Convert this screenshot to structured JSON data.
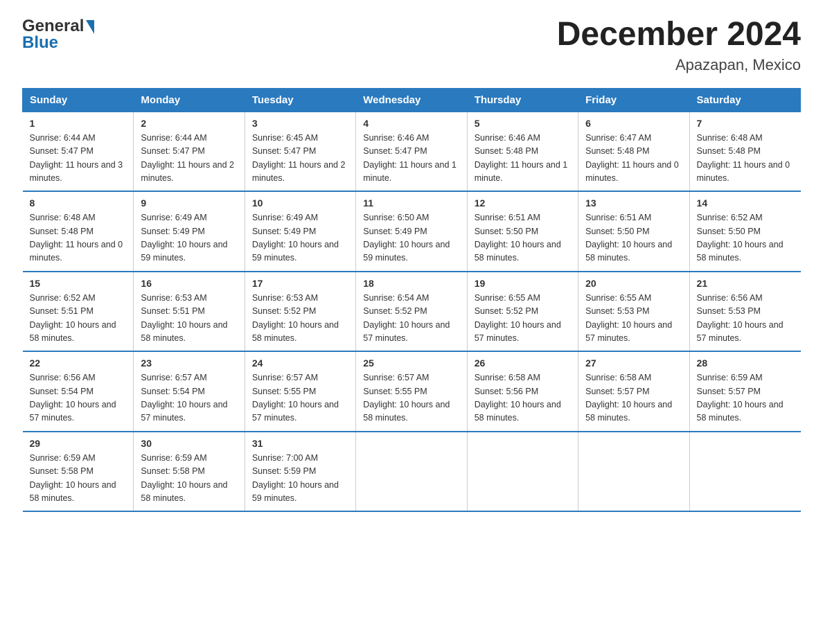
{
  "header": {
    "logo_general": "General",
    "logo_blue": "Blue",
    "month_title": "December 2024",
    "location": "Apazapan, Mexico"
  },
  "days_of_week": [
    "Sunday",
    "Monday",
    "Tuesday",
    "Wednesday",
    "Thursday",
    "Friday",
    "Saturday"
  ],
  "weeks": [
    [
      {
        "day": "1",
        "sunrise": "6:44 AM",
        "sunset": "5:47 PM",
        "daylight": "11 hours and 3 minutes."
      },
      {
        "day": "2",
        "sunrise": "6:44 AM",
        "sunset": "5:47 PM",
        "daylight": "11 hours and 2 minutes."
      },
      {
        "day": "3",
        "sunrise": "6:45 AM",
        "sunset": "5:47 PM",
        "daylight": "11 hours and 2 minutes."
      },
      {
        "day": "4",
        "sunrise": "6:46 AM",
        "sunset": "5:47 PM",
        "daylight": "11 hours and 1 minute."
      },
      {
        "day": "5",
        "sunrise": "6:46 AM",
        "sunset": "5:48 PM",
        "daylight": "11 hours and 1 minute."
      },
      {
        "day": "6",
        "sunrise": "6:47 AM",
        "sunset": "5:48 PM",
        "daylight": "11 hours and 0 minutes."
      },
      {
        "day": "7",
        "sunrise": "6:48 AM",
        "sunset": "5:48 PM",
        "daylight": "11 hours and 0 minutes."
      }
    ],
    [
      {
        "day": "8",
        "sunrise": "6:48 AM",
        "sunset": "5:48 PM",
        "daylight": "11 hours and 0 minutes."
      },
      {
        "day": "9",
        "sunrise": "6:49 AM",
        "sunset": "5:49 PM",
        "daylight": "10 hours and 59 minutes."
      },
      {
        "day": "10",
        "sunrise": "6:49 AM",
        "sunset": "5:49 PM",
        "daylight": "10 hours and 59 minutes."
      },
      {
        "day": "11",
        "sunrise": "6:50 AM",
        "sunset": "5:49 PM",
        "daylight": "10 hours and 59 minutes."
      },
      {
        "day": "12",
        "sunrise": "6:51 AM",
        "sunset": "5:50 PM",
        "daylight": "10 hours and 58 minutes."
      },
      {
        "day": "13",
        "sunrise": "6:51 AM",
        "sunset": "5:50 PM",
        "daylight": "10 hours and 58 minutes."
      },
      {
        "day": "14",
        "sunrise": "6:52 AM",
        "sunset": "5:50 PM",
        "daylight": "10 hours and 58 minutes."
      }
    ],
    [
      {
        "day": "15",
        "sunrise": "6:52 AM",
        "sunset": "5:51 PM",
        "daylight": "10 hours and 58 minutes."
      },
      {
        "day": "16",
        "sunrise": "6:53 AM",
        "sunset": "5:51 PM",
        "daylight": "10 hours and 58 minutes."
      },
      {
        "day": "17",
        "sunrise": "6:53 AM",
        "sunset": "5:52 PM",
        "daylight": "10 hours and 58 minutes."
      },
      {
        "day": "18",
        "sunrise": "6:54 AM",
        "sunset": "5:52 PM",
        "daylight": "10 hours and 57 minutes."
      },
      {
        "day": "19",
        "sunrise": "6:55 AM",
        "sunset": "5:52 PM",
        "daylight": "10 hours and 57 minutes."
      },
      {
        "day": "20",
        "sunrise": "6:55 AM",
        "sunset": "5:53 PM",
        "daylight": "10 hours and 57 minutes."
      },
      {
        "day": "21",
        "sunrise": "6:56 AM",
        "sunset": "5:53 PM",
        "daylight": "10 hours and 57 minutes."
      }
    ],
    [
      {
        "day": "22",
        "sunrise": "6:56 AM",
        "sunset": "5:54 PM",
        "daylight": "10 hours and 57 minutes."
      },
      {
        "day": "23",
        "sunrise": "6:57 AM",
        "sunset": "5:54 PM",
        "daylight": "10 hours and 57 minutes."
      },
      {
        "day": "24",
        "sunrise": "6:57 AM",
        "sunset": "5:55 PM",
        "daylight": "10 hours and 57 minutes."
      },
      {
        "day": "25",
        "sunrise": "6:57 AM",
        "sunset": "5:55 PM",
        "daylight": "10 hours and 58 minutes."
      },
      {
        "day": "26",
        "sunrise": "6:58 AM",
        "sunset": "5:56 PM",
        "daylight": "10 hours and 58 minutes."
      },
      {
        "day": "27",
        "sunrise": "6:58 AM",
        "sunset": "5:57 PM",
        "daylight": "10 hours and 58 minutes."
      },
      {
        "day": "28",
        "sunrise": "6:59 AM",
        "sunset": "5:57 PM",
        "daylight": "10 hours and 58 minutes."
      }
    ],
    [
      {
        "day": "29",
        "sunrise": "6:59 AM",
        "sunset": "5:58 PM",
        "daylight": "10 hours and 58 minutes."
      },
      {
        "day": "30",
        "sunrise": "6:59 AM",
        "sunset": "5:58 PM",
        "daylight": "10 hours and 58 minutes."
      },
      {
        "day": "31",
        "sunrise": "7:00 AM",
        "sunset": "5:59 PM",
        "daylight": "10 hours and 59 minutes."
      },
      null,
      null,
      null,
      null
    ]
  ]
}
